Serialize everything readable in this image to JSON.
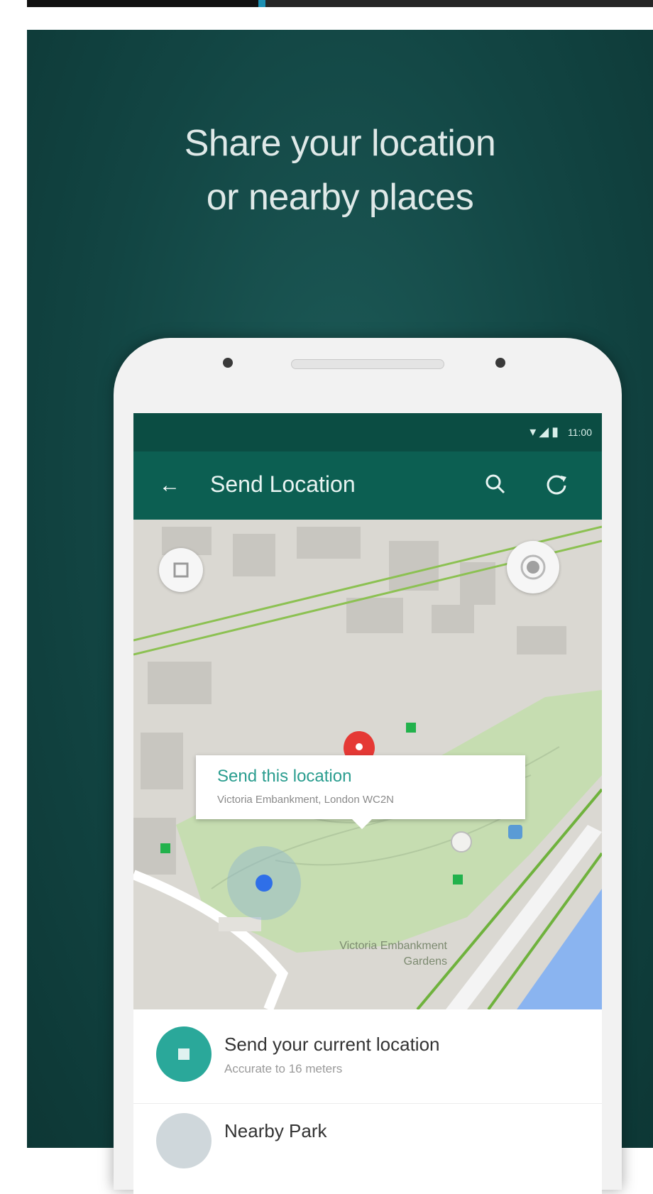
{
  "promo": {
    "headline_line1": "Share your location",
    "headline_line2": "or nearby places"
  },
  "status_bar": {
    "icons": [
      "wifi-icon",
      "signal-icon",
      "battery-icon"
    ],
    "time": "11:00"
  },
  "toolbar": {
    "back_icon": "arrow-back-icon",
    "title": "Send Location",
    "actions": [
      "search-icon",
      "refresh-icon"
    ]
  },
  "map": {
    "callout_title": "Send this location",
    "callout_subtitle": "Victoria Embankment, London WC2N",
    "park_label_line1": "Victoria Embankment",
    "park_label_line2": "Gardens",
    "left_button_icon": "layers-icon",
    "right_button_icon": "my-location-icon",
    "pin_icon": "map-pin-icon",
    "user_location_icon": "current-location-dot-icon"
  },
  "list": {
    "items": [
      {
        "title": "Send your current location",
        "subtitle": "Accurate to 16 meters",
        "icon": "location-target-icon"
      },
      {
        "title": "Nearby Park",
        "subtitle": "",
        "icon": "place-icon"
      }
    ]
  },
  "colors": {
    "background": "#124543",
    "status_bar": "#0b4d43",
    "toolbar": "#0c5f52",
    "accent": "#2aa89a",
    "pin": "#e53935",
    "park_green": "#c6ddb1"
  }
}
